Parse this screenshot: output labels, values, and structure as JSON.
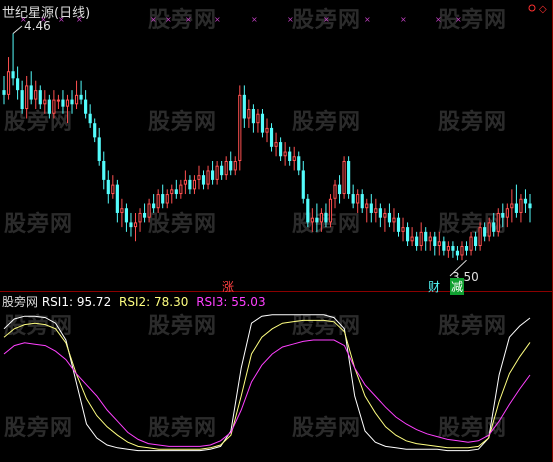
{
  "watermark": "股旁网",
  "upper": {
    "title": "世纪星源(日线)",
    "high_label": "4.46",
    "low_label": "3.50",
    "marker_zhang": "涨",
    "marker_cai": "财",
    "marker_jian": "减"
  },
  "lower": {
    "name": "股旁网",
    "rsi1_label": "RSI1:",
    "rsi1_value": "95.72",
    "rsi2_label": "RSI2:",
    "rsi2_value": "78.30",
    "rsi3_label": "RSI3:",
    "rsi3_value": "55.03"
  },
  "colors": {
    "up": "#ff5050",
    "down": "#54fcfc",
    "rsi1": "#ffffff",
    "rsi2": "#ffff80",
    "rsi3": "#ff40ff",
    "title": "#dddddd"
  },
  "chart_data": [
    {
      "type": "candlestick",
      "title": "世纪星源(日线)",
      "ylim": [
        3.45,
        4.5
      ],
      "annotations": [
        {
          "text": "4.46",
          "at_index": 2
        },
        {
          "text": "3.50",
          "at_index": 102
        },
        {
          "text": "涨",
          "at_index": 52
        },
        {
          "text": "财",
          "at_index": 101
        },
        {
          "text": "减",
          "at_index": 105
        }
      ],
      "ohlc": [
        [
          4.22,
          4.28,
          4.16,
          4.2
        ],
        [
          4.2,
          4.36,
          4.18,
          4.3
        ],
        [
          4.3,
          4.46,
          4.24,
          4.27
        ],
        [
          4.27,
          4.32,
          4.18,
          4.22
        ],
        [
          4.22,
          4.26,
          4.12,
          4.14
        ],
        [
          4.14,
          4.28,
          4.1,
          4.24
        ],
        [
          4.24,
          4.3,
          4.16,
          4.18
        ],
        [
          4.18,
          4.26,
          4.14,
          4.22
        ],
        [
          4.22,
          4.24,
          4.14,
          4.16
        ],
        [
          4.16,
          4.22,
          4.12,
          4.18
        ],
        [
          4.18,
          4.2,
          4.1,
          4.12
        ],
        [
          4.12,
          4.22,
          4.1,
          4.18
        ],
        [
          4.18,
          4.2,
          4.14,
          4.18
        ],
        [
          4.18,
          4.22,
          4.12,
          4.15
        ],
        [
          4.15,
          4.2,
          4.08,
          4.18
        ],
        [
          4.18,
          4.22,
          4.12,
          4.16
        ],
        [
          4.16,
          4.26,
          4.14,
          4.2
        ],
        [
          4.2,
          4.26,
          4.16,
          4.18
        ],
        [
          4.18,
          4.22,
          4.1,
          4.12
        ],
        [
          4.12,
          4.16,
          4.06,
          4.08
        ],
        [
          4.08,
          4.1,
          4.0,
          4.02
        ],
        [
          4.02,
          4.06,
          3.9,
          3.92
        ],
        [
          3.92,
          3.96,
          3.8,
          3.84
        ],
        [
          3.84,
          3.88,
          3.74,
          3.78
        ],
        [
          3.78,
          3.86,
          3.76,
          3.82
        ],
        [
          3.82,
          3.84,
          3.66,
          3.7
        ],
        [
          3.7,
          3.76,
          3.64,
          3.72
        ],
        [
          3.72,
          3.74,
          3.62,
          3.66
        ],
        [
          3.66,
          3.7,
          3.6,
          3.64
        ],
        [
          3.64,
          3.7,
          3.58,
          3.66
        ],
        [
          3.66,
          3.72,
          3.62,
          3.7
        ],
        [
          3.7,
          3.74,
          3.66,
          3.68
        ],
        [
          3.68,
          3.76,
          3.66,
          3.74
        ],
        [
          3.74,
          3.78,
          3.7,
          3.72
        ],
        [
          3.72,
          3.8,
          3.7,
          3.78
        ],
        [
          3.78,
          3.82,
          3.72,
          3.74
        ],
        [
          3.74,
          3.8,
          3.72,
          3.78
        ],
        [
          3.78,
          3.82,
          3.74,
          3.8
        ],
        [
          3.8,
          3.84,
          3.76,
          3.78
        ],
        [
          3.78,
          3.84,
          3.76,
          3.82
        ],
        [
          3.82,
          3.88,
          3.78,
          3.84
        ],
        [
          3.84,
          3.86,
          3.78,
          3.8
        ],
        [
          3.8,
          3.86,
          3.78,
          3.84
        ],
        [
          3.84,
          3.9,
          3.8,
          3.86
        ],
        [
          3.86,
          3.88,
          3.8,
          3.82
        ],
        [
          3.82,
          3.9,
          3.8,
          3.88
        ],
        [
          3.88,
          3.92,
          3.82,
          3.84
        ],
        [
          3.84,
          3.92,
          3.82,
          3.9
        ],
        [
          3.9,
          3.92,
          3.84,
          3.86
        ],
        [
          3.86,
          3.94,
          3.84,
          3.92
        ],
        [
          3.92,
          3.96,
          3.86,
          3.88
        ],
        [
          3.88,
          3.94,
          3.86,
          3.92
        ],
        [
          3.92,
          4.24,
          3.88,
          4.2
        ],
        [
          4.2,
          4.24,
          4.06,
          4.1
        ],
        [
          4.1,
          4.18,
          4.06,
          4.14
        ],
        [
          4.14,
          4.16,
          4.04,
          4.08
        ],
        [
          4.08,
          4.14,
          4.04,
          4.12
        ],
        [
          4.12,
          4.14,
          4.02,
          4.04
        ],
        [
          4.04,
          4.1,
          4.0,
          4.06
        ],
        [
          4.06,
          4.08,
          3.96,
          3.98
        ],
        [
          3.98,
          4.04,
          3.94,
          4.0
        ],
        [
          4.0,
          4.02,
          3.92,
          3.94
        ],
        [
          3.94,
          4.0,
          3.9,
          3.96
        ],
        [
          3.96,
          3.98,
          3.9,
          3.92
        ],
        [
          3.92,
          3.98,
          3.88,
          3.94
        ],
        [
          3.94,
          3.96,
          3.86,
          3.88
        ],
        [
          3.88,
          3.92,
          3.74,
          3.76
        ],
        [
          3.76,
          3.78,
          3.64,
          3.66
        ],
        [
          3.66,
          3.72,
          3.62,
          3.68
        ],
        [
          3.68,
          3.74,
          3.62,
          3.66
        ],
        [
          3.66,
          3.72,
          3.62,
          3.7
        ],
        [
          3.7,
          3.74,
          3.64,
          3.66
        ],
        [
          3.66,
          3.78,
          3.64,
          3.76
        ],
        [
          3.76,
          3.84,
          3.72,
          3.82
        ],
        [
          3.82,
          3.86,
          3.74,
          3.78
        ],
        [
          3.78,
          3.94,
          3.76,
          3.92
        ],
        [
          3.92,
          3.94,
          3.76,
          3.78
        ],
        [
          3.78,
          3.82,
          3.72,
          3.74
        ],
        [
          3.74,
          3.8,
          3.7,
          3.78
        ],
        [
          3.78,
          3.8,
          3.7,
          3.72
        ],
        [
          3.72,
          3.76,
          3.66,
          3.74
        ],
        [
          3.74,
          3.78,
          3.66,
          3.7
        ],
        [
          3.7,
          3.76,
          3.66,
          3.72
        ],
        [
          3.72,
          3.74,
          3.64,
          3.68
        ],
        [
          3.68,
          3.72,
          3.62,
          3.7
        ],
        [
          3.7,
          3.74,
          3.64,
          3.66
        ],
        [
          3.66,
          3.72,
          3.62,
          3.68
        ],
        [
          3.68,
          3.7,
          3.6,
          3.62
        ],
        [
          3.62,
          3.68,
          3.58,
          3.64
        ],
        [
          3.64,
          3.66,
          3.56,
          3.58
        ],
        [
          3.58,
          3.64,
          3.56,
          3.6
        ],
        [
          3.6,
          3.62,
          3.54,
          3.56
        ],
        [
          3.56,
          3.66,
          3.54,
          3.62
        ],
        [
          3.62,
          3.64,
          3.54,
          3.58
        ],
        [
          3.58,
          3.62,
          3.54,
          3.6
        ],
        [
          3.6,
          3.62,
          3.52,
          3.56
        ],
        [
          3.56,
          3.62,
          3.52,
          3.58
        ],
        [
          3.58,
          3.6,
          3.52,
          3.54
        ],
        [
          3.54,
          3.58,
          3.51,
          3.56
        ],
        [
          3.56,
          3.58,
          3.51,
          3.54
        ],
        [
          3.54,
          3.56,
          3.5,
          3.52
        ],
        [
          3.52,
          3.58,
          3.5,
          3.56
        ],
        [
          3.56,
          3.58,
          3.52,
          3.54
        ],
        [
          3.54,
          3.62,
          3.52,
          3.6
        ],
        [
          3.6,
          3.62,
          3.54,
          3.56
        ],
        [
          3.56,
          3.66,
          3.54,
          3.64
        ],
        [
          3.64,
          3.66,
          3.58,
          3.6
        ],
        [
          3.6,
          3.68,
          3.58,
          3.66
        ],
        [
          3.66,
          3.7,
          3.6,
          3.62
        ],
        [
          3.62,
          3.72,
          3.6,
          3.7
        ],
        [
          3.7,
          3.74,
          3.64,
          3.68
        ],
        [
          3.68,
          3.74,
          3.64,
          3.72
        ],
        [
          3.72,
          3.8,
          3.66,
          3.74
        ],
        [
          3.74,
          3.82,
          3.68,
          3.7
        ],
        [
          3.7,
          3.78,
          3.66,
          3.76
        ],
        [
          3.76,
          3.8,
          3.7,
          3.74
        ],
        [
          3.74,
          3.78,
          3.66,
          3.72
        ]
      ]
    },
    {
      "type": "line",
      "title": "股旁网",
      "ylim": [
        0,
        100
      ],
      "series": [
        {
          "name": "RSI1",
          "values": [
            88,
            95,
            97,
            97,
            96,
            92,
            80,
            50,
            20,
            10,
            5,
            3,
            2,
            1,
            1,
            1,
            1,
            1,
            1,
            1,
            2,
            4,
            15,
            60,
            92,
            97,
            98,
            98,
            98,
            98,
            98,
            98,
            96,
            88,
            40,
            15,
            7,
            4,
            3,
            2,
            2,
            2,
            2,
            1,
            1,
            1,
            2,
            10,
            55,
            82,
            90,
            95.72
          ]
        },
        {
          "name": "RSI2",
          "values": [
            82,
            88,
            91,
            92,
            91,
            88,
            78,
            56,
            38,
            26,
            18,
            12,
            7,
            4,
            3,
            2,
            2,
            2,
            2,
            2,
            3,
            5,
            12,
            40,
            70,
            82,
            88,
            92,
            93,
            94,
            94,
            94,
            93,
            86,
            60,
            40,
            28,
            18,
            12,
            8,
            6,
            5,
            4,
            3,
            3,
            3,
            4,
            10,
            36,
            56,
            68,
            78.3
          ]
        },
        {
          "name": "RSI3",
          "values": [
            70,
            76,
            78,
            77,
            76,
            72,
            66,
            56,
            48,
            40,
            30,
            22,
            14,
            9,
            6,
            5,
            4,
            4,
            4,
            4,
            5,
            8,
            14,
            30,
            50,
            62,
            70,
            75,
            77,
            79,
            80,
            80,
            80,
            76,
            60,
            48,
            40,
            32,
            25,
            20,
            16,
            13,
            11,
            9,
            8,
            7,
            8,
            12,
            22,
            34,
            45,
            55.03
          ]
        }
      ]
    }
  ]
}
